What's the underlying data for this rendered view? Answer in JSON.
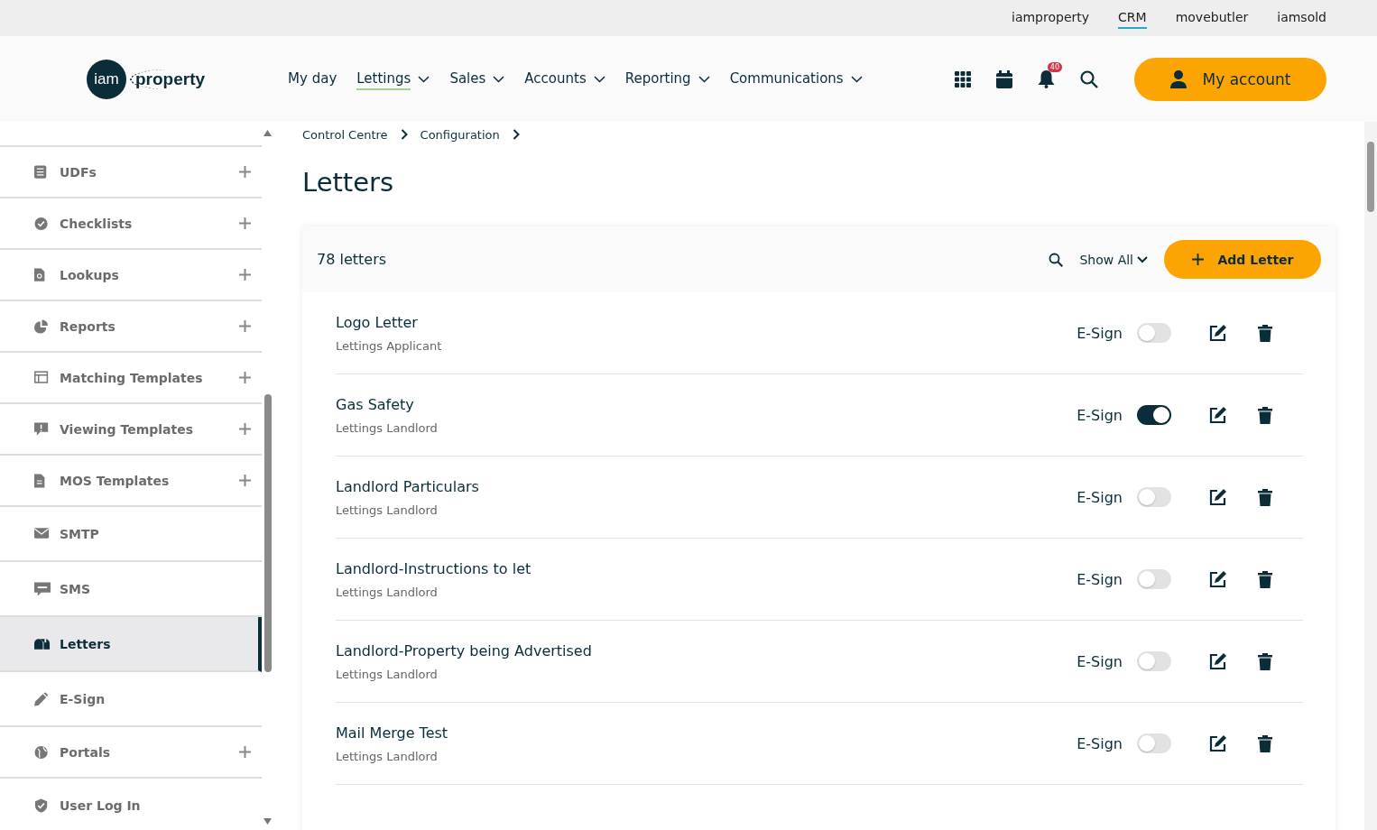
{
  "top_links": [
    {
      "label": "iamproperty",
      "selected": false
    },
    {
      "label": "CRM",
      "selected": true
    },
    {
      "label": "movebutler",
      "selected": false
    },
    {
      "label": "iamsold",
      "selected": false
    }
  ],
  "logo": {
    "badge": "iam",
    "word": "property"
  },
  "nav": [
    {
      "label": "My day",
      "dropdown": false,
      "selected": false
    },
    {
      "label": "Lettings",
      "dropdown": true,
      "selected": true
    },
    {
      "label": "Sales",
      "dropdown": true,
      "selected": false
    },
    {
      "label": "Accounts",
      "dropdown": true,
      "selected": false
    },
    {
      "label": "Reporting",
      "dropdown": true,
      "selected": false
    },
    {
      "label": "Communications",
      "dropdown": true,
      "selected": false
    }
  ],
  "notifications": {
    "count": "40"
  },
  "account_button": "My account",
  "sidebar": {
    "items": [
      {
        "label": "UDFs",
        "expandable": true,
        "selected": false
      },
      {
        "label": "Checklists",
        "expandable": true,
        "selected": false
      },
      {
        "label": "Lookups",
        "expandable": true,
        "selected": false
      },
      {
        "label": "Reports",
        "expandable": true,
        "selected": false
      },
      {
        "label": "Matching Templates",
        "expandable": true,
        "selected": false
      },
      {
        "label": "Viewing Templates",
        "expandable": true,
        "selected": false
      },
      {
        "label": "MOS Templates",
        "expandable": true,
        "selected": false
      },
      {
        "label": "SMTP",
        "expandable": false,
        "selected": false
      },
      {
        "label": "SMS",
        "expandable": false,
        "selected": false
      },
      {
        "label": "Letters",
        "expandable": false,
        "selected": true
      },
      {
        "label": "E-Sign",
        "expandable": false,
        "selected": false
      },
      {
        "label": "Portals",
        "expandable": true,
        "selected": false
      },
      {
        "label": "User Log In",
        "expandable": false,
        "selected": false
      }
    ]
  },
  "breadcrumb": [
    "Control Centre",
    "Configuration"
  ],
  "page_title": "Letters",
  "letters_panel": {
    "count": "78 letters",
    "filter": "Show All",
    "add_button": "Add Letter",
    "rows": [
      {
        "name": "Logo Letter",
        "category": "Lettings Applicant",
        "esign_label": "E-Sign",
        "esign_on": false
      },
      {
        "name": "Gas Safety",
        "category": "Lettings Landlord",
        "esign_label": "E-Sign",
        "esign_on": true
      },
      {
        "name": "Landlord Particulars",
        "category": "Lettings Landlord",
        "esign_label": "E-Sign",
        "esign_on": false
      },
      {
        "name": "Landlord-Instructions to let",
        "category": "Lettings Landlord",
        "esign_label": "E-Sign",
        "esign_on": false
      },
      {
        "name": "Landlord-Property being Advertised",
        "category": "Lettings Landlord",
        "esign_label": "E-Sign",
        "esign_on": false
      },
      {
        "name": "Mail Merge Test",
        "category": "Lettings Landlord",
        "esign_label": "E-Sign",
        "esign_on": false
      }
    ]
  }
}
